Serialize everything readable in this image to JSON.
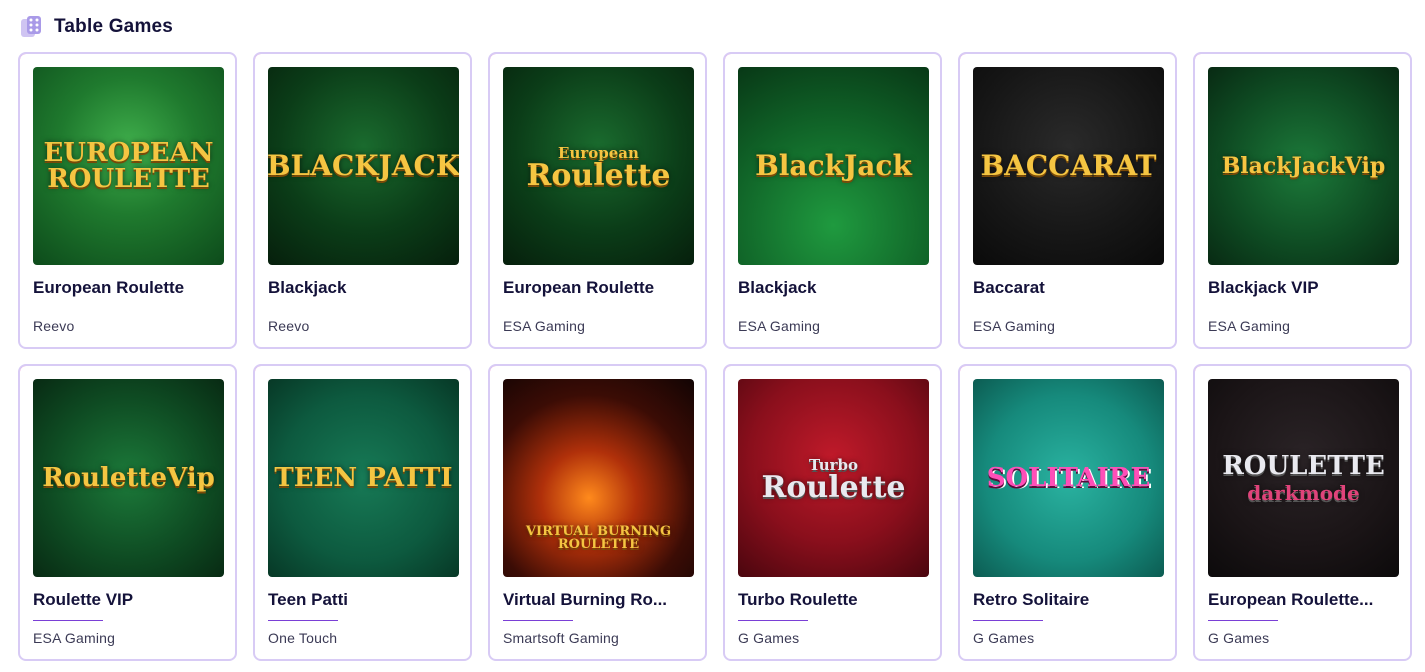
{
  "section": {
    "title": "Table Games",
    "icon": "dice-icon"
  },
  "colors": {
    "card_border": "#d8cbf5",
    "card_accent": "#e94aa8",
    "divider": "#7a3fd6",
    "title": "#14123a"
  },
  "games": [
    {
      "title": "European Roulette",
      "provider": "Reevo",
      "logo": "EUROPEAN ROULETTE",
      "logo_sub": "",
      "bg": "bg-green",
      "style": "gold",
      "size": 26
    },
    {
      "title": "Blackjack",
      "provider": "Reevo",
      "logo": "BLACKJACK",
      "logo_sub": "",
      "bg": "bg-darkgreen",
      "style": "gold",
      "size": 28
    },
    {
      "title": "European Roulette",
      "provider": "ESA Gaming",
      "logo": "Roulette",
      "logo_sub": "European",
      "bg": "bg-darkgreen",
      "style": "gold",
      "size": 30
    },
    {
      "title": "Blackjack",
      "provider": "ESA Gaming",
      "logo": "BlackJack",
      "logo_sub": "",
      "bg": "bg-table",
      "style": "gold",
      "size": 28
    },
    {
      "title": "Baccarat",
      "provider": "ESA Gaming",
      "logo": "BACCARAT",
      "logo_sub": "",
      "bg": "bg-baccarat",
      "style": "gold",
      "size": 28
    },
    {
      "title": "Blackjack VIP",
      "provider": "ESA Gaming",
      "logo": "BlackJackVip",
      "logo_sub": "",
      "bg": "bg-vip",
      "style": "gold",
      "size": 22
    },
    {
      "title": "Roulette VIP",
      "provider": "ESA Gaming",
      "logo": "RouletteVip",
      "logo_sub": "",
      "bg": "bg-vip",
      "style": "gold",
      "size": 26
    },
    {
      "title": "Teen Patti",
      "provider": "One Touch",
      "logo": "TEEN PATTI",
      "logo_sub": "",
      "bg": "bg-teen",
      "style": "gold",
      "size": 26
    },
    {
      "title": "Virtual Burning Ro...",
      "provider": "Smartsoft Gaming",
      "logo": "",
      "logo_sub": "VIRTUAL BURNING ROULETTE",
      "bg": "bg-burning",
      "style": "gold",
      "size": 20
    },
    {
      "title": "Turbo Roulette",
      "provider": "G Games",
      "logo": "Roulette",
      "logo_sub": "Turbo",
      "bg": "bg-turbo",
      "style": "silver",
      "size": 30
    },
    {
      "title": "Retro Solitaire",
      "provider": "G Games",
      "logo": "SOLITAIRE",
      "logo_sub": "",
      "bg": "bg-retro",
      "style": "pink-logo",
      "size": 26
    },
    {
      "title": "European Roulette...",
      "provider": "G Games",
      "logo": "ROULETTE",
      "logo_sub": "darkmode",
      "bg": "bg-dark",
      "style": "silver",
      "size": 26
    }
  ]
}
